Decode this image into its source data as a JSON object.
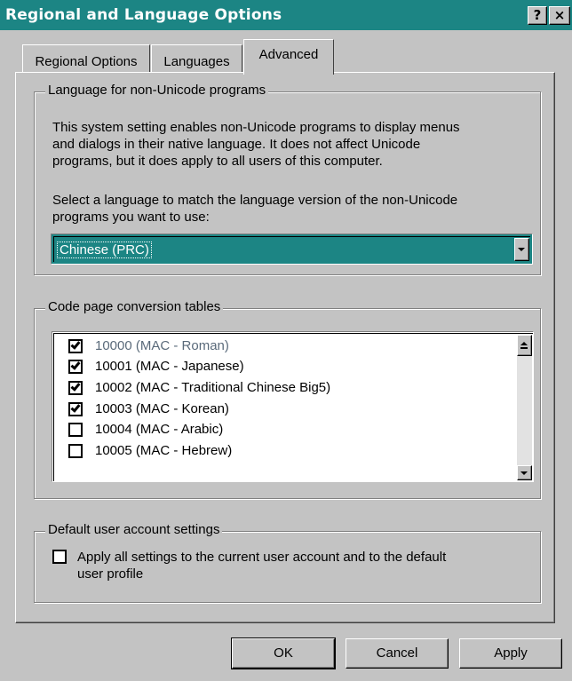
{
  "window": {
    "title": "Regional and Language Options",
    "help_button": "?",
    "close_button": "×"
  },
  "tabs": [
    {
      "label": "Regional Options",
      "active": false
    },
    {
      "label": "Languages",
      "active": false
    },
    {
      "label": "Advanced",
      "active": true
    }
  ],
  "non_unicode": {
    "legend": "Language for non-Unicode programs",
    "description": [
      "This system setting enables non-Unicode programs to display menus",
      "and dialogs in their native language. It does not affect Unicode",
      "programs, but it does apply to all users of this computer."
    ],
    "select_prompt": [
      "Select a language to match the language version of the non-Unicode",
      "programs you want to use:"
    ],
    "selected_language": "Chinese (PRC)"
  },
  "code_pages": {
    "legend": "Code page conversion tables",
    "items": [
      {
        "label": "10000 (MAC - Roman)",
        "checked": true,
        "dimmed": true
      },
      {
        "label": "10001 (MAC - Japanese)",
        "checked": true,
        "dimmed": false
      },
      {
        "label": "10002 (MAC - Traditional Chinese Big5)",
        "checked": true,
        "dimmed": false
      },
      {
        "label": "10003 (MAC - Korean)",
        "checked": true,
        "dimmed": false
      },
      {
        "label": "10004 (MAC - Arabic)",
        "checked": false,
        "dimmed": false
      },
      {
        "label": "10005 (MAC - Hebrew)",
        "checked": false,
        "dimmed": false
      }
    ]
  },
  "default_account": {
    "legend": "Default user account settings",
    "checkbox_label": [
      "Apply all settings to the current user account and to the default",
      "user profile"
    ],
    "checked": false
  },
  "buttons": {
    "ok": "OK",
    "cancel": "Cancel",
    "apply": "Apply"
  },
  "colors": {
    "title_bar": "#1c8584",
    "face": "#c3c3c3",
    "selection": "#1c8584",
    "dimmed_text": "#5a6a7a"
  }
}
